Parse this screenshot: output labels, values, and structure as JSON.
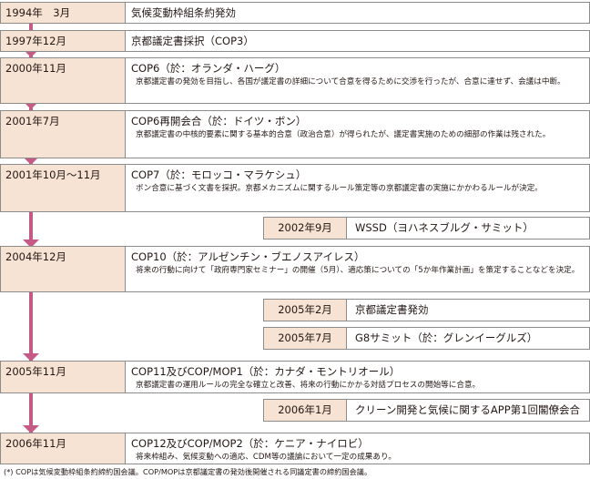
{
  "events": [
    {
      "date": "1994年　3月",
      "title": "気候変動枠組条約発効",
      "desc": ""
    },
    {
      "date": "1997年12月",
      "title": "京都議定書採択（COP3）",
      "desc": ""
    },
    {
      "date": "2000年11月",
      "title": "COP6（於：オランダ・ハーグ）",
      "desc": "京都議定書の発効を目指し、各国が議定書の詳細について合意を得るために交渉を行ったが、合意に達せず、会議は中断。"
    },
    {
      "date": "2001年7月",
      "title": "COP6再開会合（於：ドイツ・ボン）",
      "desc": "京都議定書の中核的要素に関する基本的合意（政治合意）が得られたが、議定書実施のための細部の作業は残された。"
    },
    {
      "date": "2001年10月～11月",
      "title": "COP7（於：モロッコ・マラケシュ）",
      "desc": "ボン合意に基づく文書を採択。京都メカニズムに関するルール策定等の京都議定書の実施にかかわるルールが決定。"
    },
    {
      "date": "2004年12月",
      "title": "COP10（於：アルゼンチン・ブエノスアイレス）",
      "desc": "将来の行動に向けて「政府専門家セミナー」の開催（5月）、適応策についての「5か年作業計画」を策定することなどを決定。"
    },
    {
      "date": "2005年11月",
      "title": "COP11及びCOP/MOP1（於：カナダ・モントリオール）",
      "desc": "京都議定書の運用ルールの完全な確立と改善、将来の行動にかかる対話プロセスの開始等に合意。"
    },
    {
      "date": "2006年11月",
      "title": "COP12及びCOP/MOP2（於：ケニア・ナイロビ）",
      "desc": "将来枠組み、気候変動への適応、CDM等の議論において一定の成果あり。"
    }
  ],
  "side_events": [
    {
      "date": "2002年9月",
      "title": "WSSD（ヨハネスブルグ・サミット）"
    },
    {
      "date": "2005年2月",
      "title": "京都議定書発効"
    },
    {
      "date": "2005年7月",
      "title": "G8サミット（於：グレンイーグルズ）"
    },
    {
      "date": "2006年1月",
      "title": "クリーン開発と気候に関するAPP第1回閣僚会合"
    }
  ],
  "footnote": "(*) COPは気候変動枠組条約締約国会議。COP/MOPは京都議定書の発効後開催される同議定書の締約国会議。",
  "colors": {
    "date_bg": "#f7e3d4",
    "arrow": "#c55a86",
    "border": "#8c8c8c"
  }
}
